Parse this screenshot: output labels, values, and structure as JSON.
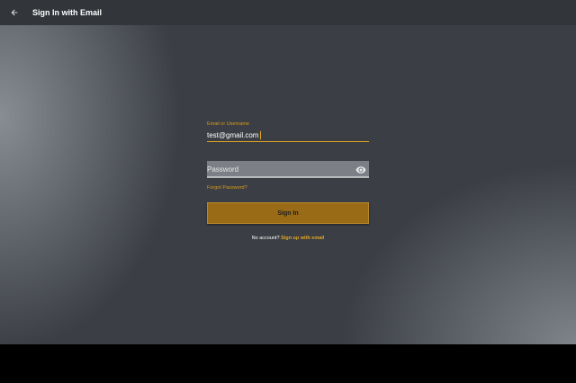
{
  "appbar": {
    "title": "Sign In with Email",
    "back_icon": "arrow-left-icon"
  },
  "form": {
    "email_label": "Email or Username",
    "email_value": "test@gmail.com",
    "password_placeholder": "Password",
    "password_value": "",
    "visibility_icon": "eye-icon",
    "forgot_link": "Forgot Password?",
    "signin_label": "Sign In",
    "signup_prompt": "No account?",
    "signup_link": "Sign up with email"
  },
  "colors": {
    "accent": "#e0a521",
    "button": "#9a6b16",
    "appbar": "#32353a",
    "background": "#3b3f45"
  }
}
